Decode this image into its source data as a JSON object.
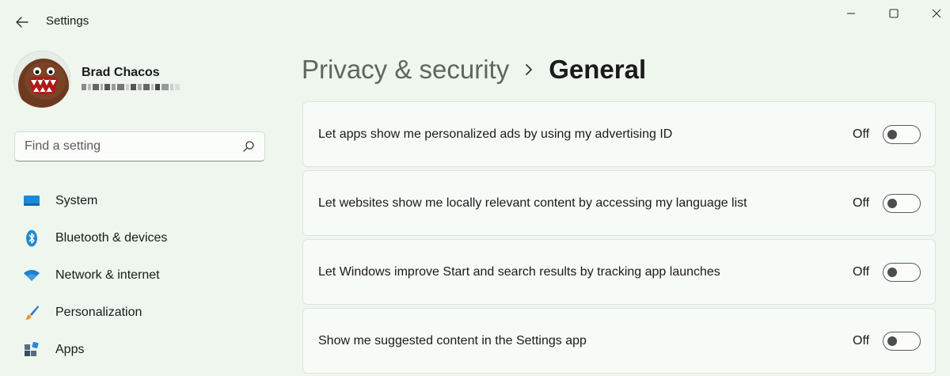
{
  "window": {
    "title": "Settings",
    "controls": {
      "minimize": "minimize-icon",
      "maximize": "maximize-icon",
      "close": "close-icon"
    }
  },
  "profile": {
    "name": "Brad Chacos",
    "email": ""
  },
  "search": {
    "placeholder": "Find a setting",
    "value": ""
  },
  "nav": {
    "items": [
      {
        "label": "System",
        "icon": "system-icon"
      },
      {
        "label": "Bluetooth & devices",
        "icon": "bluetooth-icon"
      },
      {
        "label": "Network & internet",
        "icon": "wifi-icon"
      },
      {
        "label": "Personalization",
        "icon": "brush-icon"
      },
      {
        "label": "Apps",
        "icon": "apps-icon"
      }
    ]
  },
  "breadcrumb": {
    "parent": "Privacy & security",
    "current": "General"
  },
  "settings": [
    {
      "label": "Let apps show me personalized ads by using my advertising ID",
      "state": "Off"
    },
    {
      "label": "Let websites show me locally relevant content by accessing my language list",
      "state": "Off"
    },
    {
      "label": "Let Windows improve Start and search results by tracking app launches",
      "state": "Off"
    },
    {
      "label": "Show me suggested content in the Settings app",
      "state": "Off"
    }
  ],
  "colors": {
    "background": "#eef6ee",
    "card": "#f7fbf7",
    "accent_bluetooth": "#1f8ad2",
    "system_icon": "#1e88d6"
  }
}
